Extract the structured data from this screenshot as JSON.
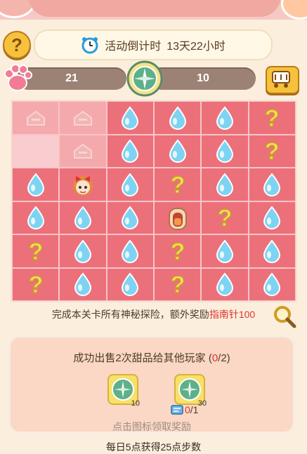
{
  "header": {
    "title": "",
    "countdown_label": "活动倒计时",
    "countdown_value": "13天22小时"
  },
  "stats": {
    "paws": "21",
    "compasses": "10"
  },
  "board": {
    "rows": 6,
    "cols": 6,
    "cells": [
      [
        "explored",
        "explored-locked",
        "drop",
        "drop",
        "drop",
        "question"
      ],
      [
        "explored-light",
        "explored-locked",
        "drop",
        "drop",
        "drop",
        "question"
      ],
      [
        "drop",
        "player",
        "drop",
        "question",
        "drop",
        "drop"
      ],
      [
        "drop",
        "drop",
        "drop",
        "chest",
        "question",
        "drop"
      ],
      [
        "question",
        "drop",
        "drop",
        "question",
        "drop",
        "drop"
      ],
      [
        "question",
        "drop",
        "drop",
        "question",
        "drop",
        "drop"
      ]
    ]
  },
  "bonus": {
    "prefix": "完成本关卡所有神秘探险，额外奖励",
    "reward_name": "指南针",
    "reward_amount": "100"
  },
  "task": {
    "text_prefix": "成功出售2次甜品给其他玩家 (",
    "progress_current": "0",
    "progress_total": "/2)",
    "rewards": [
      {
        "icon": "compass-icon",
        "qty": "10"
      },
      {
        "icon": "compass-icon",
        "qty": "30"
      }
    ],
    "ticket_current": "0",
    "ticket_total": "/1",
    "hint": "点击图标领取奖励"
  },
  "footer": {
    "daily_text": "每日5点获得25点步数"
  },
  "colors": {
    "cell_unexplored": "#ec707a",
    "cell_explored": "#f4a9ad",
    "stat_bar": "#9c8275",
    "highlight": "#e0332e"
  }
}
